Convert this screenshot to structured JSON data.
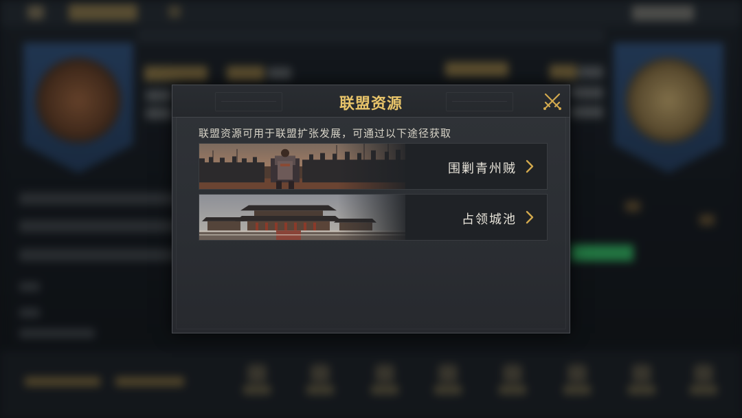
{
  "dialog": {
    "title": "联盟资源",
    "description": "联盟资源可用于联盟扩张发展，可通过以下途径获取",
    "options": [
      {
        "label": "围剿青州贼",
        "art": "army-battlefield"
      },
      {
        "label": "占领城池",
        "art": "palace-city"
      }
    ],
    "close_icon": "crossed-swords-icon"
  },
  "colors": {
    "title": "#e8c46a",
    "chevron": "#d2a94e",
    "panel": "#2d3035",
    "option_bg": "#1f2226"
  }
}
